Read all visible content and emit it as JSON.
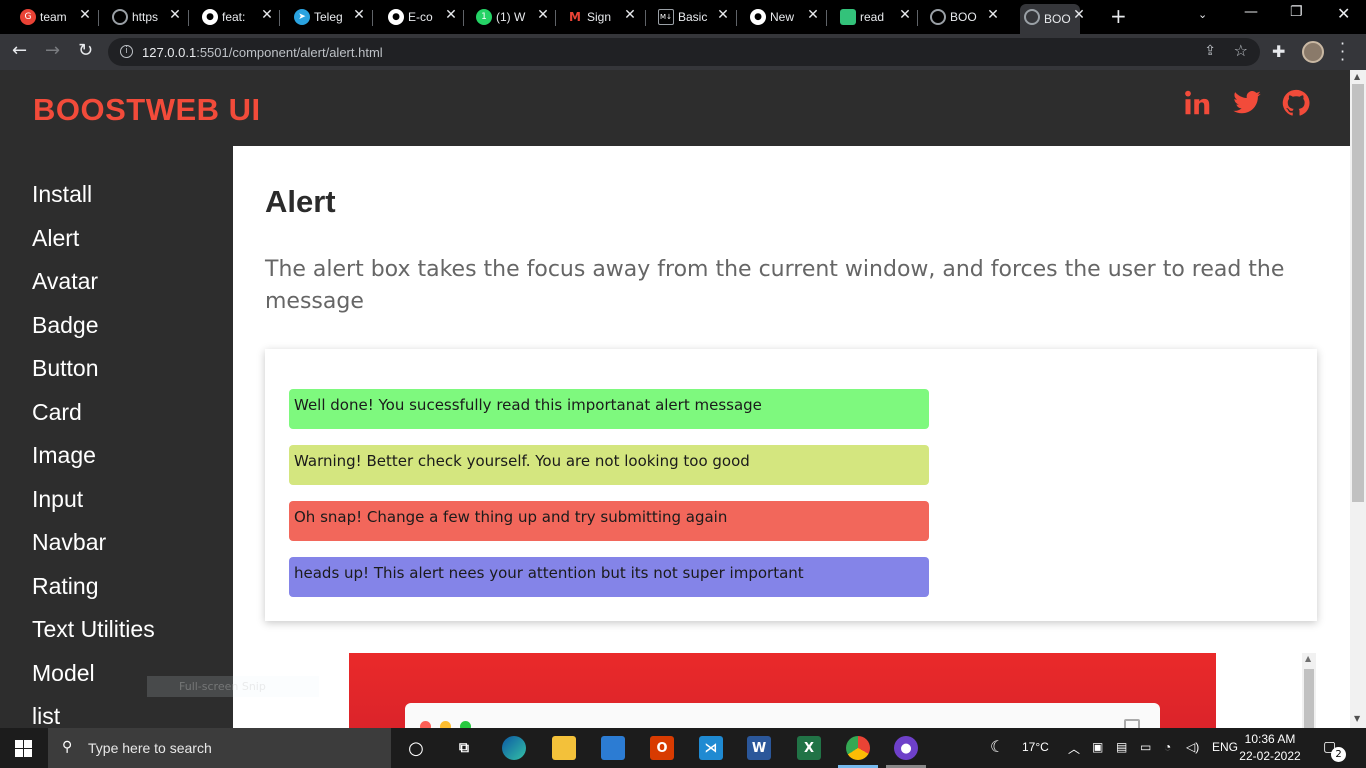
{
  "browser": {
    "tabs": [
      {
        "label": "team",
        "icon": "g2-icon",
        "color": "#e94235"
      },
      {
        "label": "https",
        "icon": "globe-icon",
        "color": "#5f6368"
      },
      {
        "label": "feat:",
        "icon": "github-icon",
        "color": "#333333"
      },
      {
        "label": "Teleg",
        "icon": "telegram-icon",
        "color": "#2aa3e0"
      },
      {
        "label": "E-co",
        "icon": "github-icon",
        "color": "#333333"
      },
      {
        "label": "(1) W",
        "icon": "whatsapp-icon",
        "color": "#25d366"
      },
      {
        "label": "Sign",
        "icon": "gmail-icon",
        "color": "#ffffff"
      },
      {
        "label": "Basic",
        "icon": "markdown-icon",
        "color": "#555555"
      },
      {
        "label": "New",
        "icon": "github-icon",
        "color": "#333333"
      },
      {
        "label": "read",
        "icon": "doc-icon",
        "color": "#33c27a"
      },
      {
        "label": "BOO",
        "icon": "globe-icon",
        "color": "#5f6368"
      },
      {
        "label": "BOO",
        "icon": "globe-icon",
        "color": "#5f6368"
      }
    ],
    "url_host": "127.0.0.1",
    "url_rest": ":5501/component/alert/alert.html"
  },
  "header": {
    "brand": "BOOSTWEB UI",
    "brand_color": "#f24b3a",
    "social_icons": [
      "linkedin-icon",
      "twitter-icon",
      "github-icon"
    ]
  },
  "sidebar": {
    "items": [
      {
        "label": "Install"
      },
      {
        "label": "Alert"
      },
      {
        "label": "Avatar"
      },
      {
        "label": "Badge"
      },
      {
        "label": "Button"
      },
      {
        "label": "Card"
      },
      {
        "label": "Image"
      },
      {
        "label": "Input"
      },
      {
        "label": "Navbar"
      },
      {
        "label": "Rating"
      },
      {
        "label": "Text Utilities"
      },
      {
        "label": "Model"
      },
      {
        "label": "list"
      }
    ]
  },
  "main": {
    "title": "Alert",
    "description": "The alert box takes the focus away from the current window, and forces the user to read the message",
    "alerts": [
      {
        "text": "Well done! You sucessfully read this importanat alert message",
        "color": "#7ef97e"
      },
      {
        "text": "Warning! Better check yourself. You are not looking too good",
        "color": "#d4e67f"
      },
      {
        "text": "Oh snap! Change a few thing up and try submitting again",
        "color": "#f2675b"
      },
      {
        "text": "heads up! This alert nees your attention but its not super important",
        "color": "#8484e8"
      }
    ]
  },
  "overlay": {
    "snip_label": "Full-screen Snip"
  },
  "taskbar": {
    "search_placeholder": "Type here to search",
    "weather": "17°C",
    "language": "ENG",
    "time": "10:36 AM",
    "date": "22-02-2022",
    "notification_count": "2"
  }
}
